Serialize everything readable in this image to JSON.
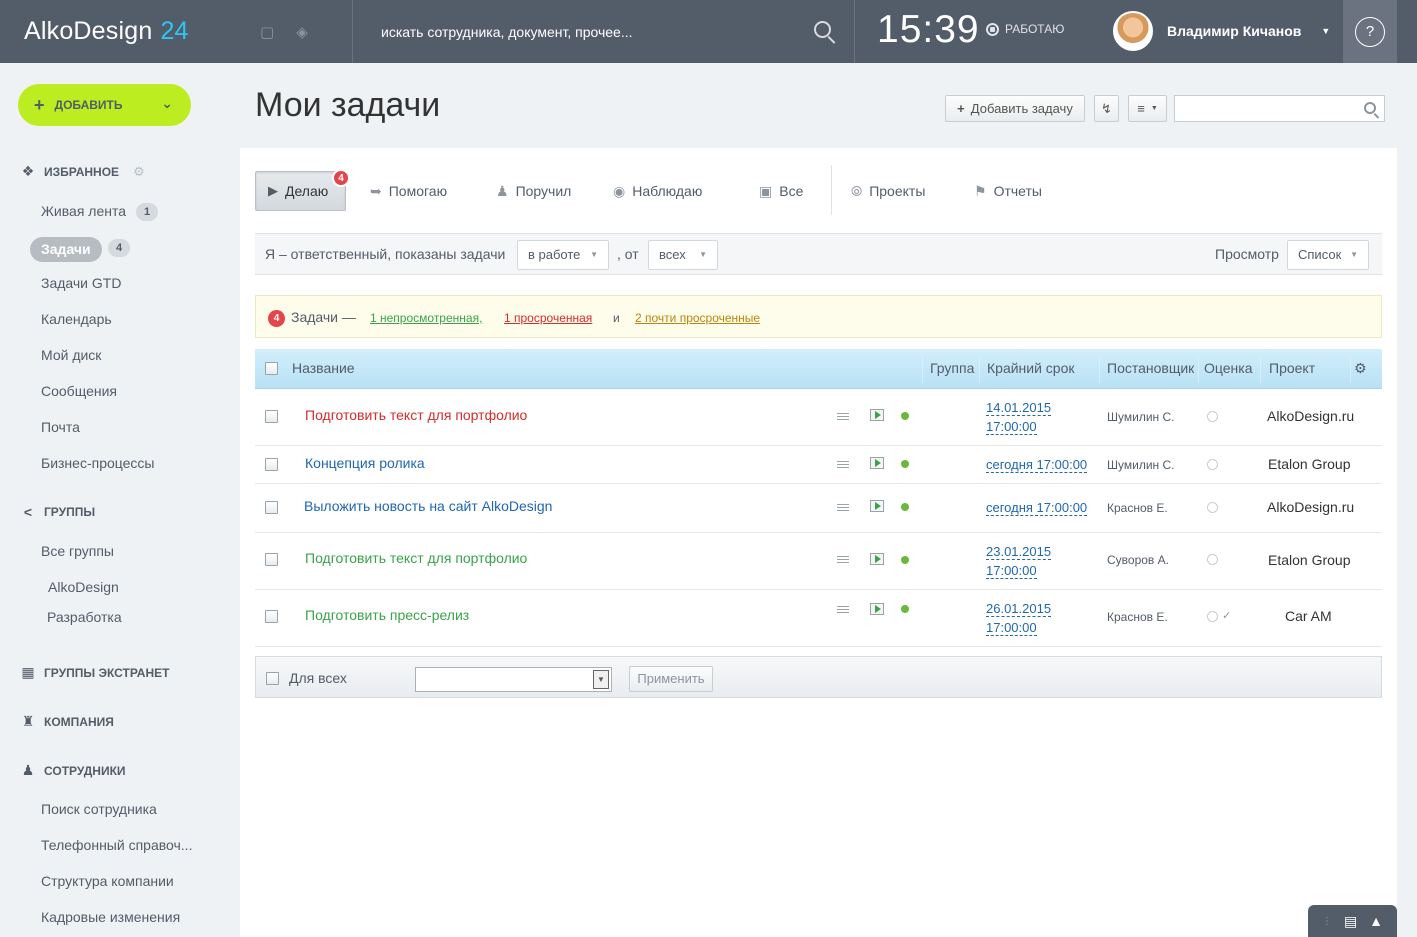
{
  "header": {
    "logo_text": "AlkoDesign",
    "logo_num": "24",
    "search_placeholder": "искать сотрудника, документ, прочее...",
    "clock": "15:39",
    "status": "РАБОТАЮ",
    "user_name": "Владимир Кичанов",
    "help": "?"
  },
  "sidebar": {
    "add_button": "ДОБАВИТЬ",
    "favorites_title": "ИЗБРАННОЕ",
    "favorites": [
      {
        "label": "Живая лента",
        "badge": "1"
      },
      {
        "label": "Задачи",
        "badge": "4"
      },
      {
        "label": "Задачи GTD"
      },
      {
        "label": "Календарь"
      },
      {
        "label": "Мой диск"
      },
      {
        "label": "Сообщения"
      },
      {
        "label": "Почта"
      },
      {
        "label": "Бизнес-процессы"
      }
    ],
    "groups_title": "ГРУППЫ",
    "groups": [
      "Все группы",
      "AlkoDesign",
      "Разработка"
    ],
    "extranet_title": "ГРУППЫ ЭКСТРАНЕТ",
    "company_title": "КОМПАНИЯ",
    "employees_title": "СОТРУДНИКИ",
    "employees": [
      "Поиск сотрудника",
      "Телефонный справоч...",
      "Структура компании",
      "Кадровые изменения"
    ]
  },
  "page": {
    "title": "Мои задачи",
    "add_task_button": "Добавить задачу"
  },
  "tabs": {
    "doing": "Делаю",
    "doing_badge": "4",
    "helping": "Помогаю",
    "assigned": "Поручил",
    "watching": "Наблюдаю",
    "all": "Все",
    "projects": "Проекты",
    "reports": "Отчеты"
  },
  "filter": {
    "text": "Я – ответственный, показаны задачи",
    "status_value": "в работе",
    "from_text": ", от",
    "from_value": "всех",
    "view_label": "Просмотр",
    "view_value": "Список"
  },
  "alert": {
    "count": "4",
    "label": "Задачи —",
    "link_unseen": "1 непросмотренная,",
    "link_overdue": "1 просроченная",
    "and": "и",
    "link_almost": "2 почти просроченные",
    "colors": {
      "unseen": "#3aa34a",
      "overdue": "#d52b2b",
      "almost": "#b8860b"
    }
  },
  "table": {
    "columns": {
      "name": "Название",
      "group": "Группа",
      "deadline": "Крайний срок",
      "creator": "Постановщик",
      "rating": "Оценка",
      "project": "Проект"
    },
    "rows": [
      {
        "name": "Подготовить текст для портфолио",
        "color": "#d52b2b",
        "deadline_1": "14.01.2015",
        "deadline_2": "17:00:00",
        "creator": "Шумилин С.",
        "project": "AlkoDesign.ru"
      },
      {
        "name": "Концепция ролика",
        "color": "#2067b0",
        "deadline_1": "сегодня 17:00:00",
        "deadline_2": "",
        "creator": "Шумилин С.",
        "project": "Etalon Group"
      },
      {
        "name": "Выложить новость на сайт AlkoDesign",
        "color": "#2067b0",
        "deadline_1": "сегодня 17:00:00",
        "deadline_2": "",
        "creator": "Краснов Е.",
        "project": "AlkoDesign.ru"
      },
      {
        "name": "Подготовить текст для портфолио",
        "color": "#3aa34a",
        "deadline_1": "23.01.2015",
        "deadline_2": "17:00:00",
        "creator": "Суворов А.",
        "project": "Etalon Group"
      },
      {
        "name": "Подготовить пресс-релиз",
        "color": "#3aa34a",
        "deadline_1": "26.01.2015",
        "deadline_2": "17:00:00",
        "creator": "Краснов Е.",
        "project": "Car AM"
      }
    ],
    "footer_label": "Для всех",
    "apply_button": "Применить"
  }
}
